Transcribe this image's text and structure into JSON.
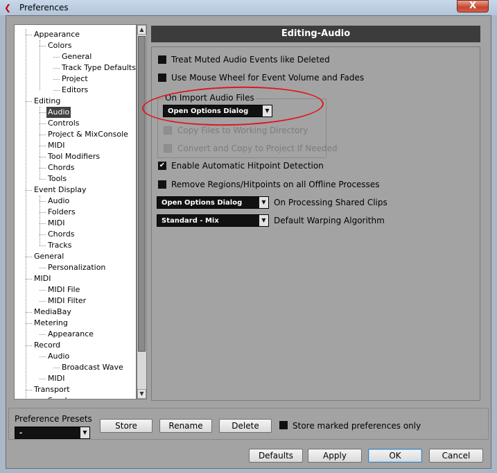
{
  "window": {
    "title": "Preferences",
    "close_label": "X"
  },
  "tree": [
    {
      "label": "Appearance",
      "level": 0
    },
    {
      "label": "Colors",
      "level": 1
    },
    {
      "label": "General",
      "level": 2
    },
    {
      "label": "Track Type Defaults",
      "level": 2
    },
    {
      "label": "Project",
      "level": 2
    },
    {
      "label": "Editors",
      "level": 2
    },
    {
      "label": "Editing",
      "level": 0
    },
    {
      "label": "Audio",
      "level": 1,
      "selected": true
    },
    {
      "label": "Controls",
      "level": 1
    },
    {
      "label": "Project & MixConsole",
      "level": 1
    },
    {
      "label": "MIDI",
      "level": 1
    },
    {
      "label": "Tool Modifiers",
      "level": 1
    },
    {
      "label": "Chords",
      "level": 1
    },
    {
      "label": "Tools",
      "level": 1
    },
    {
      "label": "Event Display",
      "level": 0
    },
    {
      "label": "Audio",
      "level": 1
    },
    {
      "label": "Folders",
      "level": 1
    },
    {
      "label": "MIDI",
      "level": 1
    },
    {
      "label": "Chords",
      "level": 1
    },
    {
      "label": "Tracks",
      "level": 1
    },
    {
      "label": "General",
      "level": 0
    },
    {
      "label": "Personalization",
      "level": 1
    },
    {
      "label": "MIDI",
      "level": 0
    },
    {
      "label": "MIDI File",
      "level": 1
    },
    {
      "label": "MIDI Filter",
      "level": 1
    },
    {
      "label": "MediaBay",
      "level": 0
    },
    {
      "label": "Metering",
      "level": 0
    },
    {
      "label": "Appearance",
      "level": 1
    },
    {
      "label": "Record",
      "level": 0
    },
    {
      "label": "Audio",
      "level": 1
    },
    {
      "label": "Broadcast Wave",
      "level": 2
    },
    {
      "label": "MIDI",
      "level": 1
    },
    {
      "label": "Transport",
      "level": 0
    },
    {
      "label": "Scrub",
      "level": 1
    }
  ],
  "panel": {
    "title": "Editing-Audio",
    "options": {
      "treat_muted": {
        "label": "Treat Muted Audio Events like Deleted",
        "checked": false
      },
      "mouse_wheel": {
        "label": "Use Mouse Wheel for Event Volume and Fades",
        "checked": false
      },
      "hitpoint": {
        "label": "Enable Automatic Hitpoint Detection",
        "checked": true
      },
      "remove_regions": {
        "label": "Remove Regions/Hitpoints on all Offline Processes",
        "checked": false
      }
    },
    "import_group": {
      "label": "On Import Audio Files",
      "dropdown_value": "Open Options Dialog",
      "copy_files": {
        "label": "Copy Files to Working Directory",
        "checked": false
      },
      "convert_copy": {
        "label": "Convert and Copy to Project If Needed",
        "checked": false
      }
    },
    "shared_clips": {
      "value": "Open Options Dialog",
      "label": "On Processing Shared Clips"
    },
    "warping": {
      "value": "Standard - Mix",
      "label": "Default Warping Algorithm"
    }
  },
  "presets": {
    "label": "Preference Presets",
    "selected": "-",
    "store": "Store",
    "rename": "Rename",
    "delete": "Delete",
    "store_marked": {
      "label": "Store marked preferences only",
      "checked": false
    }
  },
  "footer": {
    "defaults": "Defaults",
    "apply": "Apply",
    "ok": "OK",
    "cancel": "Cancel"
  },
  "colors": {
    "annotation": "#e0161c",
    "selection": "#414141",
    "background": "#a3a3a3"
  },
  "icons": {
    "app": "cubase-icon",
    "check": "check-icon",
    "dropdown": "chevron-down-icon"
  }
}
